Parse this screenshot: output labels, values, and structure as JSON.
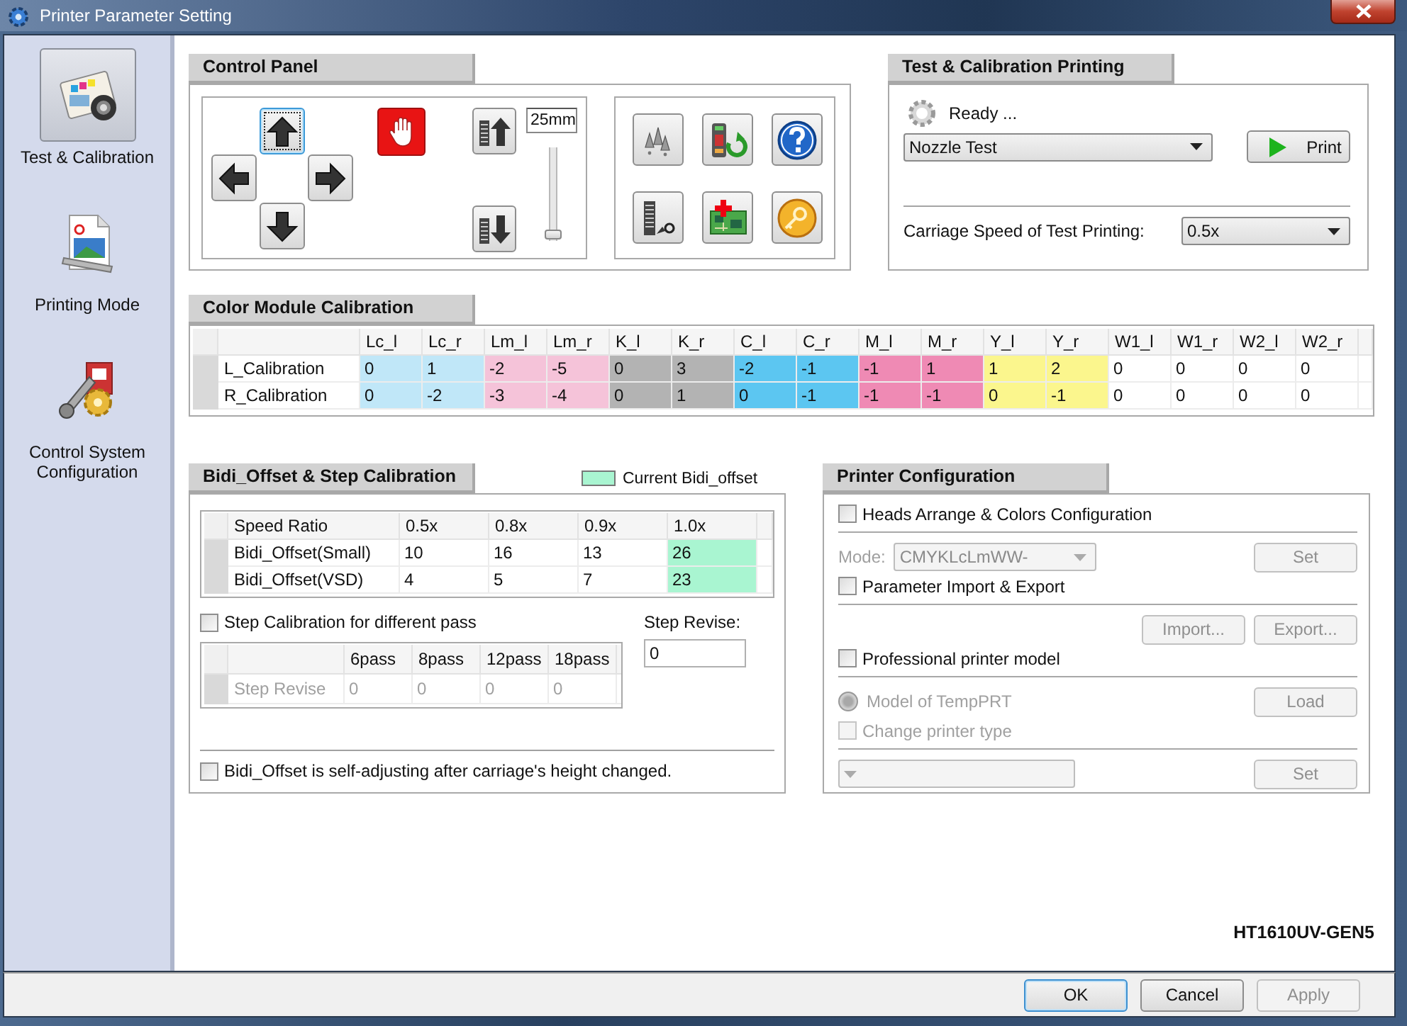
{
  "window": {
    "title": "Printer Parameter Setting"
  },
  "sidebar": {
    "items": [
      {
        "label": "Test & Calibration",
        "selected": true
      },
      {
        "label": "Printing Mode",
        "selected": false
      },
      {
        "label": "Control System Configuration",
        "selected": false
      }
    ]
  },
  "control_panel": {
    "title": "Control Panel",
    "step_value": "25mm",
    "slider": {
      "level": 0
    }
  },
  "test_printing": {
    "title": "Test & Calibration Printing",
    "status": "Ready ...",
    "pattern": "Nozzle Test",
    "print_button": "Print",
    "speed_label": "Carriage Speed of Test Printing:",
    "speed": "0.5x"
  },
  "color_calibration": {
    "title": "Color Module Calibration",
    "columns": [
      {
        "label": "Lc_l",
        "color": "#c0e7f8"
      },
      {
        "label": "Lc_r",
        "color": "#c0e7f8"
      },
      {
        "label": "Lm_l",
        "color": "#f5c3d9"
      },
      {
        "label": "Lm_r",
        "color": "#f5c3d9"
      },
      {
        "label": "K_l",
        "color": "#b3b3b3"
      },
      {
        "label": "K_r",
        "color": "#b3b3b3"
      },
      {
        "label": "C_l",
        "color": "#5cc6f1"
      },
      {
        "label": "C_r",
        "color": "#5cc6f1"
      },
      {
        "label": "M_l",
        "color": "#ef8ab4"
      },
      {
        "label": "M_r",
        "color": "#ef8ab4"
      },
      {
        "label": "Y_l",
        "color": "#fbf68d"
      },
      {
        "label": "Y_r",
        "color": "#fbf68d"
      },
      {
        "label": "W1_l"
      },
      {
        "label": "W1_r"
      },
      {
        "label": "W2_l"
      },
      {
        "label": "W2_r"
      }
    ],
    "rows": [
      {
        "label": "L_Calibration",
        "values": [
          "0",
          "1",
          "-2",
          "-5",
          "0",
          "3",
          "-2",
          "-1",
          "-1",
          "1",
          "1",
          "2",
          "0",
          "0",
          "0",
          "0"
        ]
      },
      {
        "label": "R_Calibration",
        "values": [
          "0",
          "-2",
          "-3",
          "-4",
          "0",
          "1",
          "0",
          "-1",
          "-1",
          "-1",
          "0",
          "-1",
          "0",
          "0",
          "0",
          "0"
        ]
      }
    ]
  },
  "bidi": {
    "title": "Bidi_Offset & Step Calibration",
    "legend": "Current Bidi_offset",
    "corner": "Speed Ratio",
    "columns": [
      {
        "label": "0.5x",
        "current": false
      },
      {
        "label": "0.8x",
        "current": false
      },
      {
        "label": "0.9x",
        "current": false
      },
      {
        "label": "1.0x",
        "current": true
      }
    ],
    "rows": [
      {
        "label": "Bidi_Offset(Small)",
        "values": [
          "10",
          "16",
          "13",
          "26"
        ]
      },
      {
        "label": "Bidi_Offset(VSD)",
        "values": [
          "4",
          "5",
          "7",
          "23"
        ]
      }
    ],
    "step": {
      "label": "Step Calibration for different pass",
      "checked": false,
      "disabled": true,
      "columns": [
        "6pass",
        "8pass",
        "12pass",
        "18pass"
      ],
      "rows": [
        {
          "label": "Step Revise",
          "values": [
            "0",
            "0",
            "0",
            "0"
          ]
        }
      ],
      "revise_label": "Step Revise:",
      "revise_value": "0"
    },
    "self_adjust": {
      "label": "Bidi_Offset is self-adjusting after carriage's height changed.",
      "checked": false
    }
  },
  "printer_config": {
    "title": "Printer Configuration",
    "sections": [
      {
        "kind": "checkbox",
        "label": "Heads Arrange & Colors Configuration",
        "checked": false,
        "disabled": false
      },
      {
        "kind": "mode",
        "label": "Mode:",
        "value": "CMYKLcLmWW-",
        "button": "Set",
        "disabled": true
      },
      {
        "kind": "checkbox",
        "label": "Parameter Import & Export",
        "checked": false,
        "disabled": false
      },
      {
        "kind": "buttons",
        "buttons": [
          "Import...",
          "Export..."
        ],
        "disabled": true
      },
      {
        "kind": "checkbox",
        "label": "Professional printer model",
        "checked": false,
        "disabled": false
      },
      {
        "kind": "radio",
        "label": "Model of TempPRT",
        "selected": false,
        "button": "Load",
        "disabled": true
      },
      {
        "kind": "checkbox",
        "label": "Change printer type",
        "checked": false,
        "disabled": true
      },
      {
        "kind": "select",
        "button": "Set",
        "disabled": true
      }
    ]
  },
  "model_name": "HT1610UV-GEN5",
  "buttons": [
    {
      "label": "OK",
      "disabled": false
    },
    {
      "label": "Cancel",
      "disabled": false
    },
    {
      "label": "Apply",
      "disabled": true
    }
  ]
}
